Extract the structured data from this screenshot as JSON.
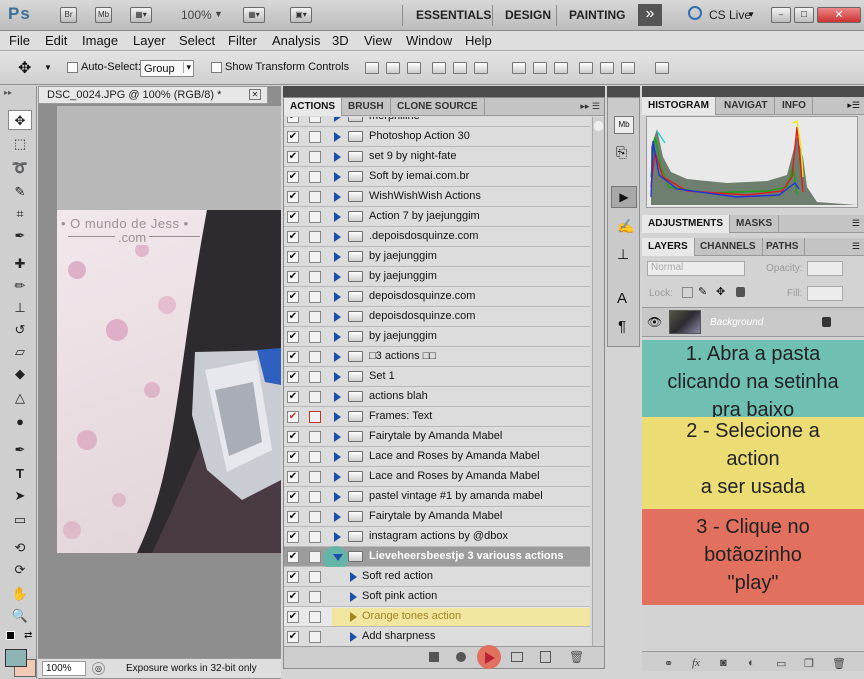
{
  "app": {
    "logo": "Ps",
    "bridge_btn": "Br",
    "minibridge_btn": "Mb",
    "zoom": "100%",
    "workspaces": [
      "ESSENTIALS",
      "DESIGN",
      "PAINTING"
    ],
    "more_btn": "»",
    "cs_live": "CS Live",
    "cs_live_arrow": "▾",
    "window_controls": {
      "minimize": "–",
      "maximize": "☐",
      "close": "✕"
    }
  },
  "menu": [
    "File",
    "Edit",
    "Image",
    "Layer",
    "Select",
    "Filter",
    "Analysis",
    "3D",
    "View",
    "Window",
    "Help"
  ],
  "options": {
    "auto_select_label": "Auto-Select:",
    "auto_select_value": "Group",
    "transform_label": "Show Transform Controls"
  },
  "document": {
    "tab_title": "DSC_0024.JPG @ 100% (RGB/8) *",
    "close_glyph": "✕",
    "watermark_line1": "• O mundo de Jess •",
    "watermark_line2": ".com",
    "status_zoom": "100%",
    "status_text": "Exposure works in 32-bit only"
  },
  "actions_panel": {
    "tabs": [
      "ACTIONS",
      "BRUSH",
      "CLONE SOURCE"
    ],
    "menu_glyph": "▸▸ ☰",
    "partial_top": "merpniline",
    "sets": [
      "Photoshop Action 30",
      "set 9 by night-fate",
      "Soft by iemai.com.br",
      "WishWishWish Actions",
      "Action 7 by jaejunggim",
      ".depoisdosquinze.com",
      "by jaejunggim",
      "by jaejunggim",
      "depoisdosquinze.com",
      "depoisdosquinze.com",
      "by jaejunggim",
      "□3 actions □□",
      "Set 1",
      "actions blah",
      "Frames: Text",
      "Fairytale by Amanda Mabel",
      "Lace and Roses by Amanda Mabel",
      "Lace and Roses by Amanda Mabel",
      "pastel vintage #1 by amanda mabel",
      "Fairytale by Amanda Mabel",
      "instagram actions by @dbox"
    ],
    "open_set": "Lieveheersbeestje 3 variouss actions",
    "open_actions": [
      "Soft red action",
      "Soft pink action",
      "Orange tones action",
      "Add sharpness"
    ],
    "selected_action": "Orange tones action"
  },
  "right_panel": {
    "top_tabs": [
      "HISTOGRAM",
      "NAVIGAT",
      "INFO"
    ],
    "adj_tabs": [
      "ADJUSTMENTS",
      "MASKS"
    ],
    "layer_tabs": [
      "LAYERS",
      "CHANNELS",
      "PATHS"
    ],
    "blend_mode": "Normal",
    "opacity_label": "Opacity:",
    "lock_label": "Lock:",
    "fill_label": "Fill:",
    "layer_name": "Background",
    "footer_icons": [
      "link-icon",
      "fx-icon",
      "mask-icon",
      "adjustment-icon",
      "group-icon",
      "new-layer-icon",
      "trash-icon"
    ]
  },
  "annotations": {
    "step1": [
      "1. Abra a pasta",
      "clicando na setinha",
      "pra baixo"
    ],
    "step2": [
      "2 - Selecione a",
      "action",
      "a ser usada"
    ],
    "step3": [
      "3 - Clique no",
      "botãozinho",
      "\"play\""
    ]
  },
  "colors": {
    "annot_teal": "#6fbfb2",
    "annot_yellow": "#ecdc74",
    "annot_red": "#e2705f",
    "selected_row": "#f1e6a0",
    "disclosure_blue": "#1b4fa8"
  }
}
